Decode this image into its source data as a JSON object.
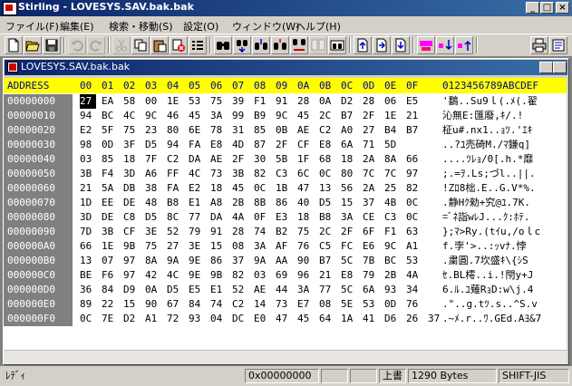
{
  "window": {
    "title": "Stirling - LOVESYS.SAV.bak.bak"
  },
  "window_buttons": {
    "minimize": "_",
    "maximize": "□",
    "close": "×"
  },
  "menu": [
    "ファイル(F)",
    "編集(E)",
    "検索・移動(S)",
    "設定(O)",
    "ウィンドウ(W)",
    "ヘルプ(H)"
  ],
  "child": {
    "title": "LOVESYS.SAV.bak.bak"
  },
  "header": {
    "address": "ADDRESS",
    "cols": [
      "00",
      "01",
      "02",
      "03",
      "04",
      "05",
      "06",
      "07",
      "08",
      "09",
      "0A",
      "0B",
      "0C",
      "0D",
      "0E",
      "0F"
    ],
    "ascii": "0123456789ABCDEF"
  },
  "rows": [
    {
      "addr": "00000000",
      "bytes": [
        "27",
        "EA",
        "58",
        "00",
        "1E",
        "53",
        "75",
        "39",
        "F1",
        "91",
        "28",
        "0A",
        "D2",
        "28",
        "06",
        "E5"
      ],
      "ascii": "'鷭..Su9ｌ(.ﾒ(.翟"
    },
    {
      "addr": "00000010",
      "bytes": [
        "94",
        "BC",
        "4C",
        "9C",
        "46",
        "45",
        "3A",
        "99",
        "B9",
        "9C",
        "45",
        "2C",
        "B7",
        "2F",
        "1E",
        "21"
      ],
      "ascii": "沁無E:匯廢,ｷ/.!"
    },
    {
      "addr": "00000020",
      "bytes": [
        "E2",
        "5F",
        "75",
        "23",
        "80",
        "6E",
        "78",
        "31",
        "85",
        "0B",
        "AE",
        "C2",
        "A0",
        "27",
        "B4",
        "B7"
      ],
      "ascii": "柾u#.nx1..ｮﾂ.'ｴｷ"
    },
    {
      "addr": "00000030",
      "bytes": [
        "98",
        "0D",
        "3F",
        "D5",
        "94",
        "FA",
        "E8",
        "4D",
        "87",
        "2F",
        "CF",
        "E8",
        "6A",
        "71",
        "5D"
      ],
      "ascii": "..?ﾕ売碕M./ﾏ鎌q]"
    },
    {
      "addr": "00000040",
      "bytes": [
        "03",
        "85",
        "18",
        "7F",
        "C2",
        "DA",
        "AE",
        "2F",
        "30",
        "5B",
        "1F",
        "68",
        "18",
        "2A",
        "8A",
        "66"
      ],
      "ascii": "....ﾂﾚｮ/0[.h.*靡"
    },
    {
      "addr": "00000050",
      "bytes": [
        "3B",
        "F4",
        "3D",
        "A6",
        "FF",
        "4C",
        "73",
        "3B",
        "82",
        "C3",
        "6C",
        "0C",
        "80",
        "7C",
        "7C",
        "97"
      ],
      "ascii": ";.=ｦ.Ls;づl..||."
    },
    {
      "addr": "00000060",
      "bytes": [
        "21",
        "5A",
        "DB",
        "38",
        "FA",
        "E2",
        "18",
        "45",
        "0C",
        "1B",
        "47",
        "13",
        "56",
        "2A",
        "25",
        "82"
      ],
      "ascii": "!Zﾛ8柮.E..G.V*%."
    },
    {
      "addr": "00000070",
      "bytes": [
        "1D",
        "EE",
        "DE",
        "48",
        "B8",
        "E1",
        "A8",
        "2B",
        "8B",
        "86",
        "40",
        "D5",
        "15",
        "37",
        "4B",
        "0C"
      ],
      "ascii": ".静Hｸ勑+究@ﾕ.7K."
    },
    {
      "addr": "00000080",
      "bytes": [
        "3D",
        "DE",
        "C8",
        "D5",
        "8C",
        "77",
        "DA",
        "4A",
        "0F",
        "E3",
        "18",
        "B8",
        "3A",
        "CE",
        "C3",
        "0C"
      ],
      "ascii": "=ﾞﾈ詣wﾚJ...ｸ:ﾎﾃ."
    },
    {
      "addr": "00000090",
      "bytes": [
        "7D",
        "3B",
        "CF",
        "3E",
        "52",
        "79",
        "91",
        "28",
        "74",
        "B2",
        "75",
        "2C",
        "2F",
        "6F",
        "F1",
        "63"
      ],
      "ascii": "};ﾏ>Ry.(tｲu,/oｌc"
    },
    {
      "addr": "000000A0",
      "bytes": [
        "66",
        "1E",
        "9B",
        "75",
        "27",
        "3E",
        "15",
        "08",
        "3A",
        "AF",
        "76",
        "C5",
        "FC",
        "E6",
        "9C",
        "A1"
      ],
      "ascii": "f.孛'>..:ｯvﾅ.悖"
    },
    {
      "addr": "000000B0",
      "bytes": [
        "13",
        "07",
        "97",
        "8A",
        "9A",
        "9E",
        "86",
        "37",
        "9A",
        "AA",
        "90",
        "B7",
        "5C",
        "7B",
        "BC",
        "53"
      ],
      "ascii": ".粛圓.7坎盛ｷ\\{ｼS"
    },
    {
      "addr": "000000C0",
      "bytes": [
        "BE",
        "F6",
        "97",
        "42",
        "4C",
        "9E",
        "9B",
        "82",
        "03",
        "69",
        "96",
        "21",
        "E8",
        "79",
        "2B",
        "4A"
      ],
      "ascii": "ｾ.BL樗..i.!閇y+J"
    },
    {
      "addr": "000000D0",
      "bytes": [
        "36",
        "84",
        "D9",
        "0A",
        "D5",
        "E5",
        "E1",
        "52",
        "AE",
        "44",
        "3A",
        "77",
        "5C",
        "6A",
        "93",
        "34"
      ],
      "ascii": "6.ﾙ.ﾕ薙RｮD:w\\j.4"
    },
    {
      "addr": "000000E0",
      "bytes": [
        "89",
        "22",
        "15",
        "90",
        "67",
        "84",
        "74",
        "C2",
        "14",
        "73",
        "E7",
        "08",
        "5E",
        "53",
        "0D",
        "76"
      ],
      "ascii": ".\"..g.tﾂ.s..^S.v"
    },
    {
      "addr": "000000F0",
      "bytes": [
        "0C",
        "7E",
        "D2",
        "A1",
        "72",
        "93",
        "04",
        "DC",
        "E0",
        "47",
        "45",
        "64",
        "1A",
        "41",
        "D6",
        "26",
        "37"
      ],
      "ascii": ".~ﾒ.r..ﾜ.GEd.Aﾖ&7"
    }
  ],
  "status": {
    "left": "ﾚﾃﾞｨ",
    "offset": "0x00000000",
    "mode": "上書",
    "size": "1290 Bytes",
    "encoding": "SHIFT-JIS"
  }
}
